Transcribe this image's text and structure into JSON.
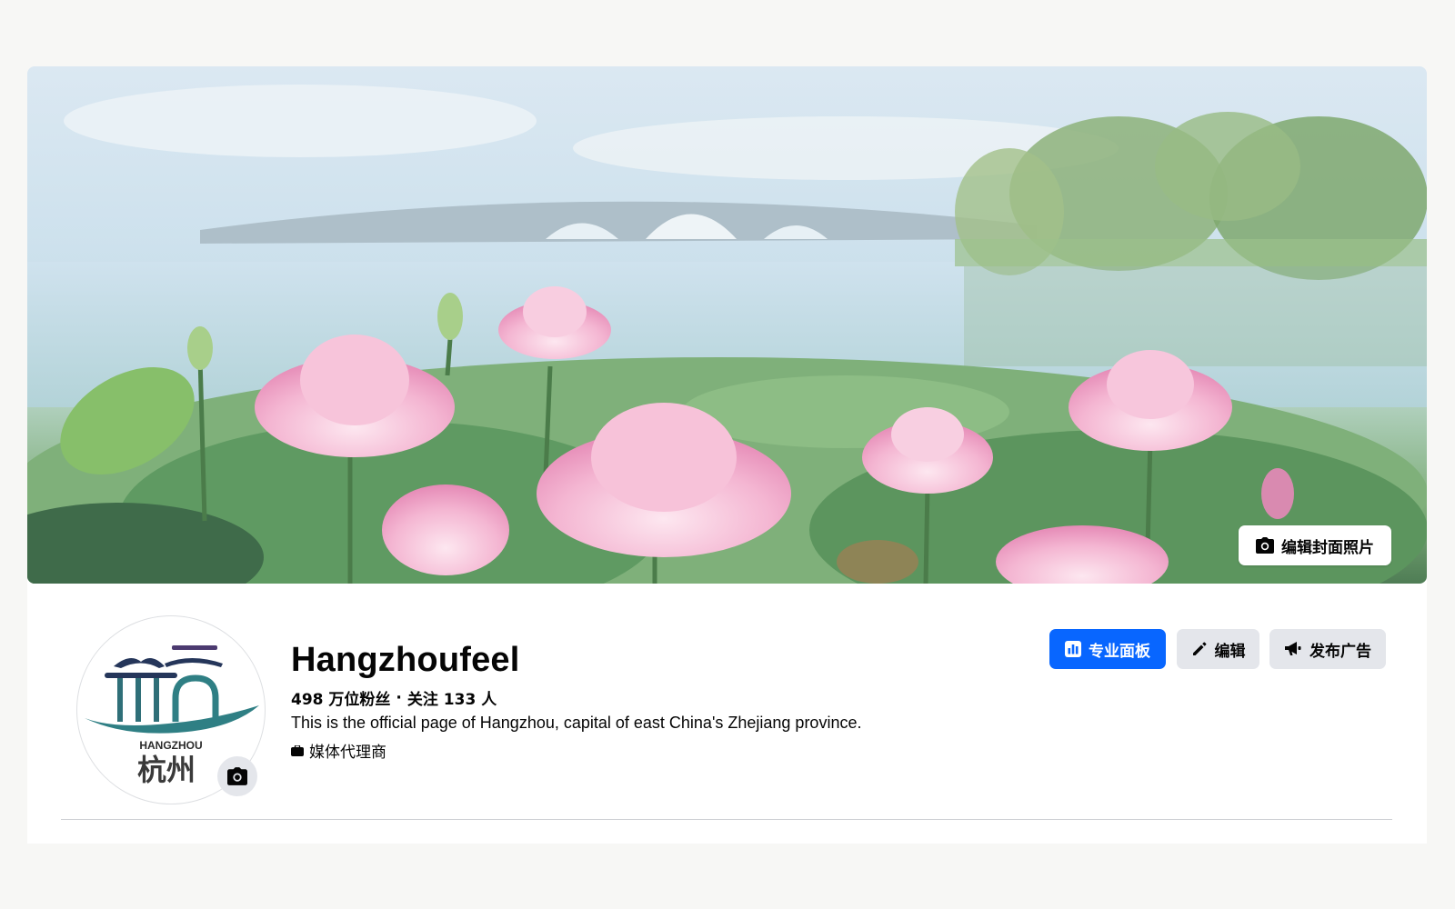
{
  "cover": {
    "edit_cover_label": "编辑封面照片"
  },
  "profile": {
    "name": "Hangzhoufeel",
    "followers": "498 万位粉丝",
    "separator": "·",
    "following": "关注 133 人",
    "bio": "This is the official page of Hangzhou, capital of east China's Zhejiang province.",
    "category": "媒体代理商",
    "avatar_logo_text": "HANGZHOU",
    "avatar_logo_cn": "杭州"
  },
  "actions": {
    "dashboard_label": "专业面板",
    "edit_label": "编辑",
    "advertise_label": "发布广告"
  },
  "colors": {
    "primary": "#0866ff",
    "secondary_btn": "#e4e6eb",
    "text": "#050505",
    "logo_teal": "#2f7f84",
    "logo_navy": "#25365a"
  },
  "icons": {
    "camera": "camera-icon",
    "dashboard": "dashboard-icon",
    "pencil": "pencil-icon",
    "megaphone": "megaphone-icon",
    "category": "briefcase-icon"
  }
}
